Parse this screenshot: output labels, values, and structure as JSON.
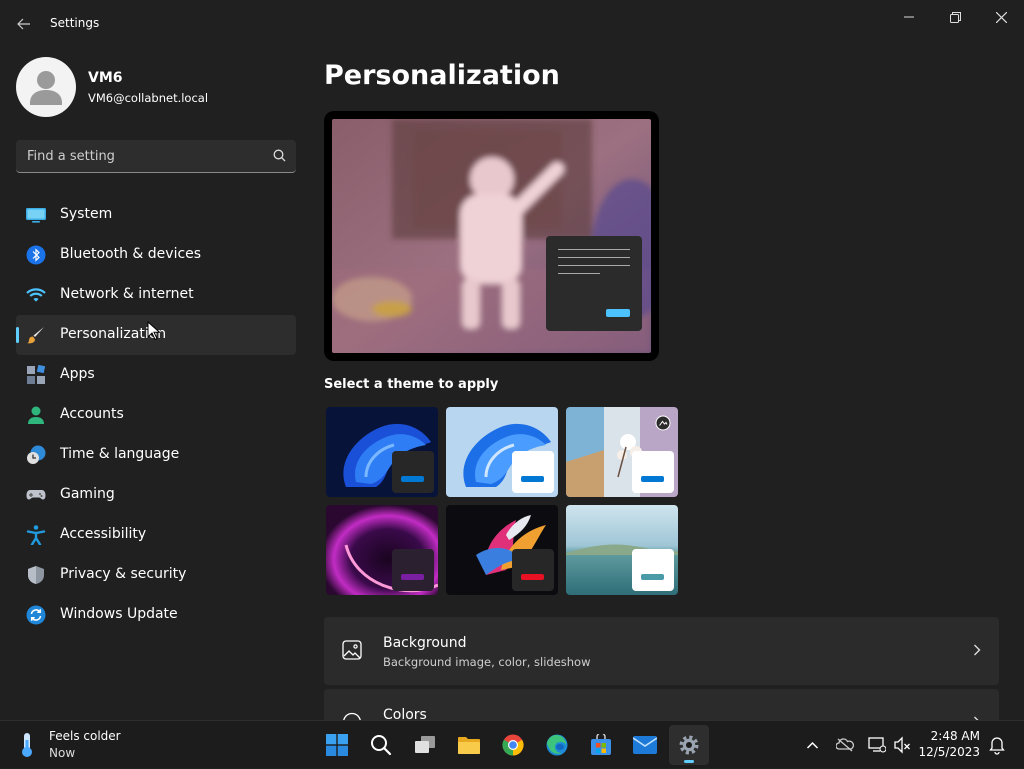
{
  "window": {
    "title": "Settings",
    "controls": {
      "minimize": "minimize-icon",
      "restore": "restore-icon",
      "close": "close-icon"
    }
  },
  "profile": {
    "name": "VM6",
    "email": "VM6@collabnet.local"
  },
  "search": {
    "placeholder": "Find a setting"
  },
  "nav": {
    "items": [
      {
        "label": "System",
        "icon": "system-icon"
      },
      {
        "label": "Bluetooth & devices",
        "icon": "bluetooth-icon"
      },
      {
        "label": "Network & internet",
        "icon": "wifi-icon"
      },
      {
        "label": "Personalization",
        "icon": "brush-icon",
        "selected": true
      },
      {
        "label": "Apps",
        "icon": "apps-icon"
      },
      {
        "label": "Accounts",
        "icon": "accounts-icon"
      },
      {
        "label": "Time & language",
        "icon": "clock-globe-icon"
      },
      {
        "label": "Gaming",
        "icon": "gamepad-icon"
      },
      {
        "label": "Accessibility",
        "icon": "accessibility-icon"
      },
      {
        "label": "Privacy & security",
        "icon": "shield-icon"
      },
      {
        "label": "Windows Update",
        "icon": "update-icon"
      }
    ]
  },
  "main": {
    "title": "Personalization",
    "theme_section_label": "Select a theme to apply",
    "themes": [
      {
        "name": "windows-dark",
        "accent": "#0078d4"
      },
      {
        "name": "windows-light",
        "accent": "#0078d4"
      },
      {
        "name": "windows-spotlight",
        "accent": "#0078d4"
      },
      {
        "name": "glow",
        "accent": "#7a1fa2"
      },
      {
        "name": "captured-motion",
        "accent": "#e81123"
      },
      {
        "name": "flow",
        "accent": "#4a9aa8"
      }
    ],
    "cards": [
      {
        "title": "Background",
        "subtitle": "Background image, color, slideshow"
      },
      {
        "title": "Colors",
        "subtitle": ""
      }
    ]
  },
  "taskbar": {
    "weather": {
      "line1": "Feels colder",
      "line2": "Now"
    },
    "apps": [
      "start-icon",
      "search-icon",
      "task-view-icon",
      "file-explorer-icon",
      "chrome-icon",
      "edge-icon",
      "store-icon",
      "mail-icon",
      "settings-icon"
    ],
    "clock": {
      "time": "2:48 AM",
      "date": "12/5/2023"
    }
  },
  "colors": {
    "accent": "#60cdff",
    "background": "#202020",
    "card": "#2b2b2b"
  }
}
